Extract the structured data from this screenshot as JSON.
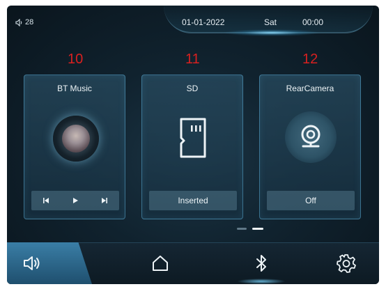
{
  "status": {
    "volume_level": "28",
    "date": "01-01-2022",
    "day": "Sat",
    "time": "00:00"
  },
  "cards": [
    {
      "number": "10",
      "title": "BT Music",
      "footer_icons": [
        "previous-icon",
        "play-icon",
        "next-icon"
      ]
    },
    {
      "number": "11",
      "title": "SD",
      "footer": "Inserted",
      "icon": "sd-card-icon"
    },
    {
      "number": "12",
      "title": "RearCamera",
      "footer": "Off",
      "icon": "camera-icon"
    }
  ],
  "pagination": {
    "pages": 2,
    "current": 2
  },
  "bottom_nav": [
    "volume-icon",
    "home-icon",
    "bluetooth-icon",
    "settings-icon"
  ],
  "colors": {
    "accent": "#3a7ea6",
    "number_label": "#d82020",
    "text": "#eef4f7"
  }
}
